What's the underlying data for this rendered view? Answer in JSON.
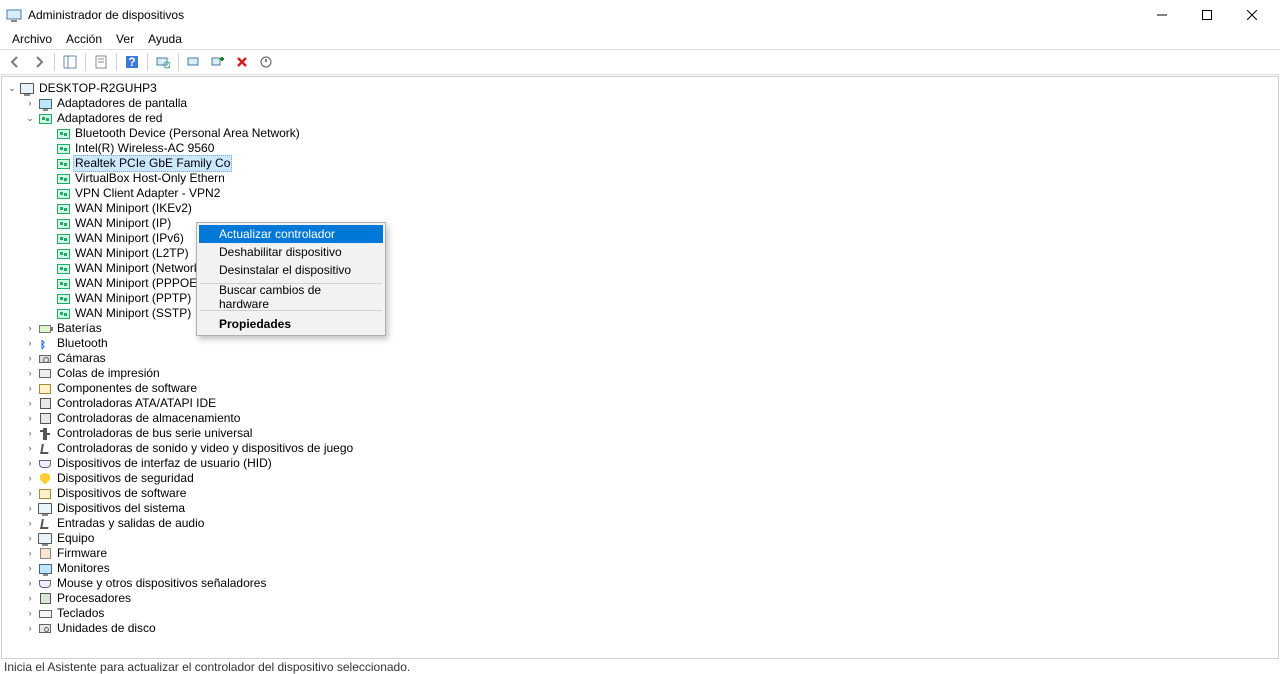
{
  "window": {
    "title": "Administrador de dispositivos"
  },
  "menu": {
    "archivo": "Archivo",
    "accion": "Acción",
    "ver": "Ver",
    "ayuda": "Ayuda"
  },
  "root": {
    "name": "DESKTOP-R2GUHP3"
  },
  "categories": {
    "display_adapters": "Adaptadores de pantalla",
    "network_adapters": "Adaptadores de red"
  },
  "network_devices": {
    "bt_pan": "Bluetooth Device (Personal Area Network)",
    "intel_wifi": "Intel(R) Wireless-AC 9560",
    "realtek": "Realtek PCIe GbE Family Co",
    "vbox": "VirtualBox Host-Only Ethern",
    "vpn": "VPN Client Adapter - VPN2",
    "wan_ikev2": "WAN Miniport (IKEv2)",
    "wan_ip": "WAN Miniport (IP)",
    "wan_ipv6": "WAN Miniport (IPv6)",
    "wan_l2tp": "WAN Miniport (L2TP)",
    "wan_netmon": "WAN Miniport (Network Monitor)",
    "wan_pppoe": "WAN Miniport (PPPOE)",
    "wan_pptp": "WAN Miniport (PPTP)",
    "wan_sstp": "WAN Miniport (SSTP)"
  },
  "other_categories": {
    "batteries": "Baterías",
    "bluetooth": "Bluetooth",
    "cameras": "Cámaras",
    "print_queues": "Colas de impresión",
    "software_components": "Componentes de software",
    "ata": "Controladoras ATA/ATAPI IDE",
    "storage": "Controladoras de almacenamiento",
    "usb": "Controladoras de bus serie universal",
    "sound": "Controladoras de sonido y video y dispositivos de juego",
    "hid": "Dispositivos de interfaz de usuario (HID)",
    "security": "Dispositivos de seguridad",
    "software_devices": "Dispositivos de software",
    "system": "Dispositivos del sistema",
    "audio_io": "Entradas y salidas de audio",
    "computer": "Equipo",
    "firmware": "Firmware",
    "monitors": "Monitores",
    "mice": "Mouse y otros dispositivos señaladores",
    "processors": "Procesadores",
    "keyboards": "Teclados",
    "disks": "Unidades de disco"
  },
  "context_menu": {
    "update": "Actualizar controlador",
    "disable": "Deshabilitar dispositivo",
    "uninstall": "Desinstalar el dispositivo",
    "scan": "Buscar cambios de hardware",
    "properties": "Propiedades"
  },
  "statusbar": "Inicia el Asistente para actualizar el controlador del dispositivo seleccionado."
}
